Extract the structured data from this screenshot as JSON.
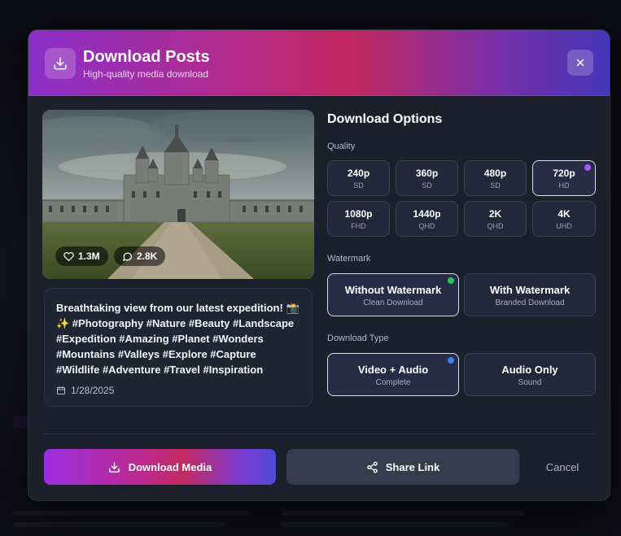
{
  "header": {
    "title": "Download Posts",
    "subtitle": "High-quality media download",
    "icon": "download-icon",
    "close_icon": "close-icon"
  },
  "preview": {
    "likes": "1.3M",
    "comments": "2.8K",
    "like_icon": "heart-icon",
    "comment_icon": "comment-icon"
  },
  "post": {
    "caption_line1": "Breathtaking view from our latest expedition! 📸",
    "caption_line2": "✨ #Photography #Nature #Beauty #Landscape",
    "caption_line3": "#Expedition #Amazing #Planet #Wonders",
    "caption_line4": "#Mountains #Valleys #Explore #Capture",
    "caption_line5": "#Wildlife #Adventure #Travel #Inspiration",
    "date": "1/28/2025",
    "date_icon": "calendar-icon"
  },
  "options": {
    "title": "Download Options",
    "quality_label": "Quality",
    "quality": [
      {
        "main": "240p",
        "sub": "SD",
        "selected": false
      },
      {
        "main": "360p",
        "sub": "SD",
        "selected": false
      },
      {
        "main": "480p",
        "sub": "SD",
        "selected": false
      },
      {
        "main": "720p",
        "sub": "HD",
        "selected": true
      },
      {
        "main": "1080p",
        "sub": "FHD",
        "selected": false
      },
      {
        "main": "1440p",
        "sub": "QHD",
        "selected": false
      },
      {
        "main": "2K",
        "sub": "QHD",
        "selected": false
      },
      {
        "main": "4K",
        "sub": "UHD",
        "selected": false
      }
    ],
    "watermark_label": "Watermark",
    "watermark": [
      {
        "main": "Without Watermark",
        "sub": "Clean Download",
        "selected": true
      },
      {
        "main": "With Watermark",
        "sub": "Branded Download",
        "selected": false
      }
    ],
    "type_label": "Download Type",
    "type": [
      {
        "main": "Video + Audio",
        "sub": "Complete",
        "selected": true
      },
      {
        "main": "Audio Only",
        "sub": "Sound",
        "selected": false
      }
    ]
  },
  "actions": {
    "download_label": "Download Media",
    "share_label": "Share Link",
    "cancel_label": "Cancel"
  },
  "colors": {
    "quality_dot": "#a855f7",
    "watermark_dot": "#22c55e",
    "type_dot": "#3b82f6"
  }
}
